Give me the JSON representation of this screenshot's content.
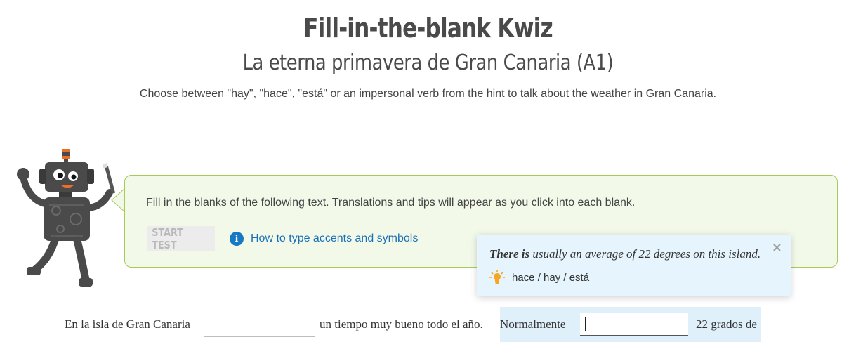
{
  "header": {
    "title": "Fill-in-the-blank Kwiz",
    "subtitle": "La eterna primavera de Gran Canaria (A1)",
    "description": "Choose between \"hay\", \"hace\", \"está\" or an impersonal verb from the hint to talk about the weather in Gran Canaria."
  },
  "panel": {
    "instructions": "Fill in the blanks of the following text. Translations and tips will appear as you click into each blank.",
    "start_button": "START TEST",
    "howto_link": "How to type accents and symbols",
    "info_icon": "i"
  },
  "tooltip": {
    "bold_part": "There is",
    "rest": " usually an average of 22 degrees on this island.",
    "hint": "hace / hay / está",
    "close": "×"
  },
  "exercise": {
    "seg1": "En la isla de Gran Canaria",
    "seg2": "un tiempo muy bueno todo el año.",
    "seg3": "Normalmente",
    "seg4": "22 grados de",
    "blank1_value": "",
    "blank2_value": ""
  },
  "colors": {
    "accent_link": "#1a6fb7",
    "panel_border": "#a7c957",
    "panel_bg": "#f3f9e9",
    "tooltip_bg": "#e5f4fd"
  }
}
